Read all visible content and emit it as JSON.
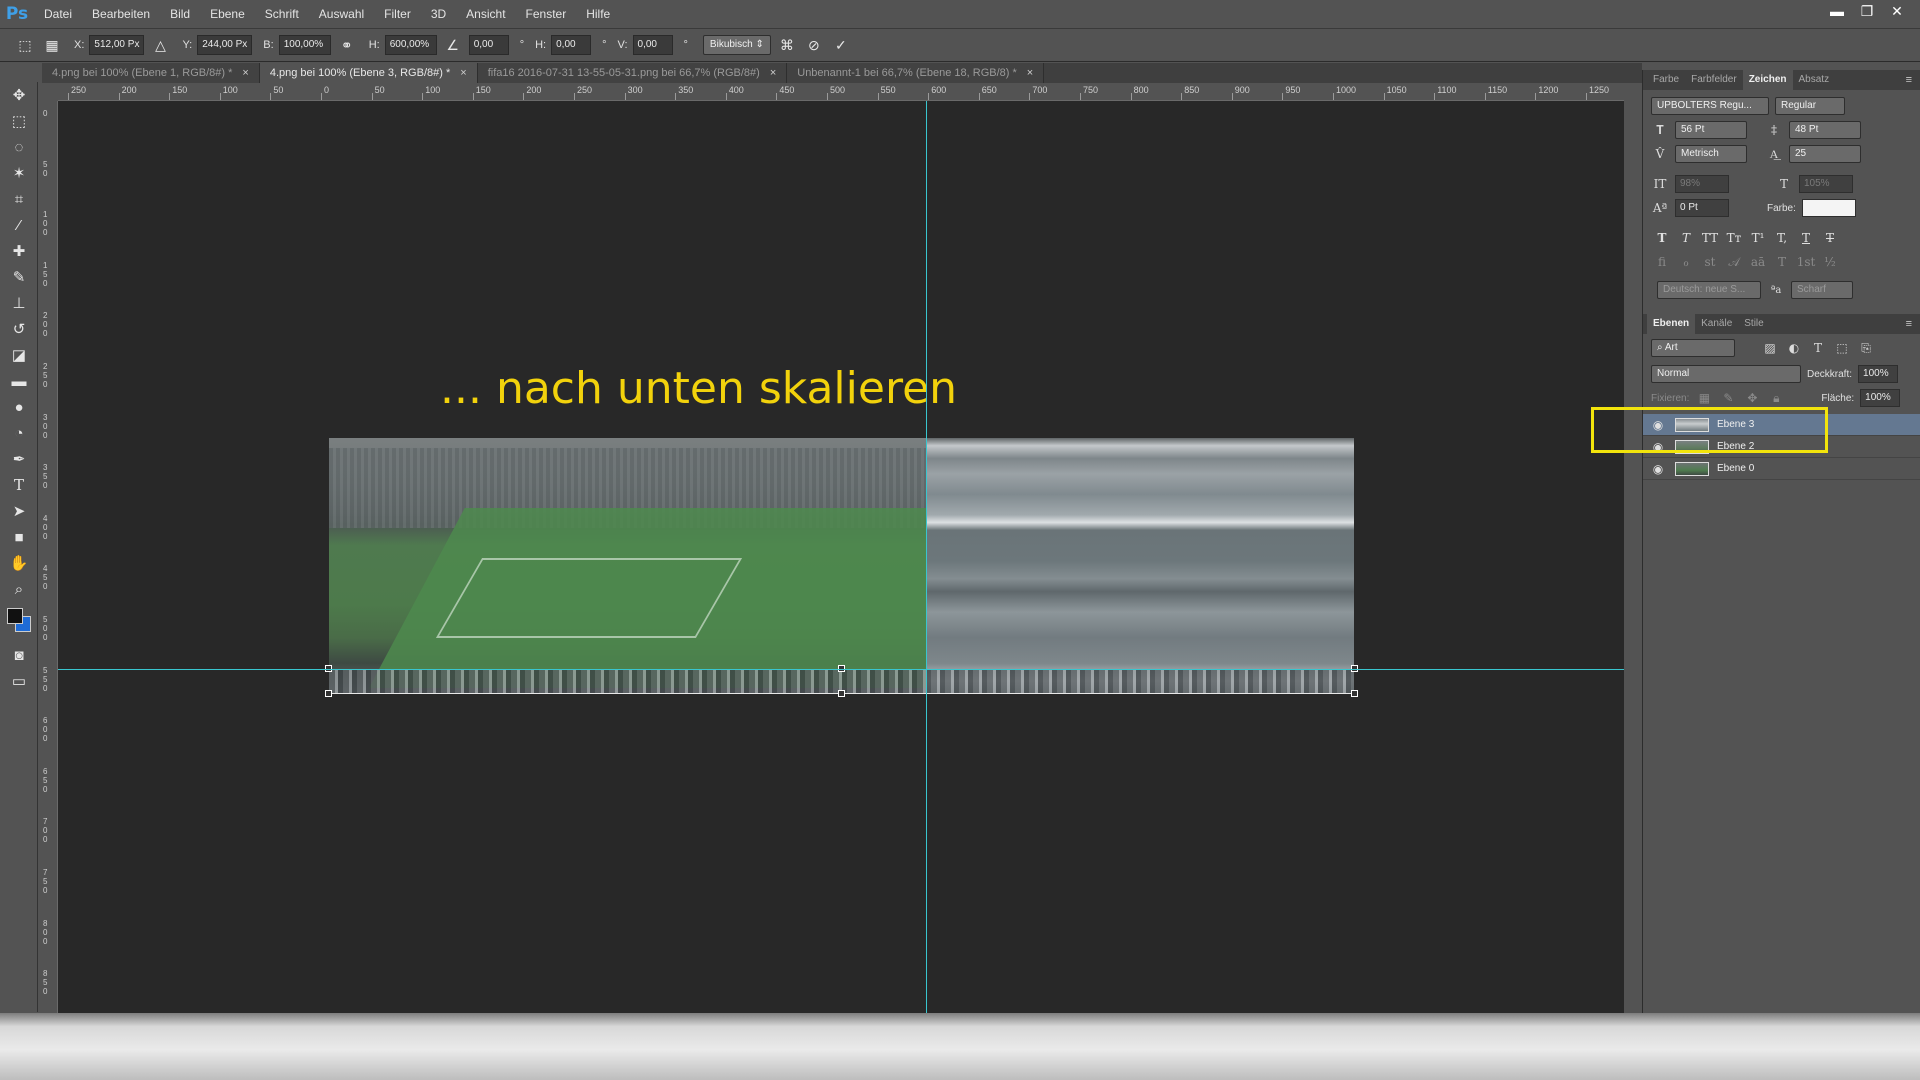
{
  "app": {
    "logo": "Ps"
  },
  "menu": [
    "Datei",
    "Bearbeiten",
    "Bild",
    "Ebene",
    "Schrift",
    "Auswahl",
    "Filter",
    "3D",
    "Ansicht",
    "Fenster",
    "Hilfe"
  ],
  "window_controls": {
    "minimize": "▬",
    "restore": "❐",
    "close": "✕"
  },
  "options": {
    "x_label": "X:",
    "x_value": "512,00 Px",
    "y_label": "Y:",
    "y_value": "244,00 Px",
    "w_label": "B:",
    "w_value": "100,00%",
    "h_label": "H:",
    "h_value": "600,00%",
    "angle_value": "0,00",
    "hskew_label": "H:",
    "hskew_value": "0,00",
    "vskew_label": "V:",
    "vskew_value": "0,00",
    "interpolation": "Bikubisch",
    "degree": "°"
  },
  "tabs": [
    {
      "label": "4.png bei 100% (Ebene 1, RGB/8#) *",
      "close": "×"
    },
    {
      "label": "4.png bei 100% (Ebene 3, RGB/8#) *",
      "close": "×"
    },
    {
      "label": "fifa16 2016-07-31 13-55-05-31.png bei 66,7% (RGB/8#)",
      "close": "×"
    },
    {
      "label": "Unbenannt-1 bei 66,7% (Ebene 18, RGB/8) *",
      "close": "×"
    }
  ],
  "ruler_top": [
    "250",
    "200",
    "150",
    "100",
    "50",
    "0",
    "50",
    "100",
    "150",
    "200",
    "250",
    "300",
    "350",
    "400",
    "450",
    "500",
    "550",
    "600",
    "650",
    "700",
    "750",
    "800",
    "850",
    "900",
    "950",
    "1000",
    "1050",
    "1100",
    "1150",
    "1200",
    "1250"
  ],
  "ruler_left": [
    "0",
    "5 0",
    "1 0 0",
    "1 5 0",
    "2 0 0",
    "2 5 0",
    "3 0 0",
    "3 5 0",
    "4 0 0",
    "4 5 0",
    "5 0 0",
    "5 5 0",
    "6 0 0",
    "6 5 0",
    "7 0 0",
    "7 5 0",
    "8 0 0",
    "8 5 0"
  ],
  "canvas": {
    "caption": "... nach unten skalieren"
  },
  "colors": {
    "caption": "#f2d20c",
    "guide": "#39c6cf",
    "highlight": "#f2e40c",
    "foreground": "#111111",
    "background": "#1e6bd6"
  },
  "char_panel": {
    "tabs": [
      "Farbe",
      "Farbfelder",
      "Zeichen",
      "Absatz"
    ],
    "font_family": "UPBOLTERS Regu...",
    "font_style": "Regular",
    "size": "56 Pt",
    "leading": "48 Pt",
    "kerning": "Metrisch",
    "tracking": "25",
    "vscale": "98%",
    "hscale": "105%",
    "baseline": "0 Pt",
    "color_label": "Farbe:",
    "style_buttons": [
      "T",
      "T",
      "TT",
      "Tт",
      "T¹",
      "T,",
      "T",
      "T"
    ],
    "opentype_buttons": [
      "ﬁ",
      "ℴ",
      "st",
      "𝒜",
      "aā",
      "T",
      "1st",
      "½"
    ],
    "language": "Deutsch: neue S...",
    "aa_icon": "ªa",
    "antialias": "Scharf"
  },
  "layers_panel": {
    "tabs": [
      "Ebenen",
      "Kanäle",
      "Stile"
    ],
    "filter": "Art",
    "blend_mode": "Normal",
    "opacity_label": "Deckkraft:",
    "opacity": "100%",
    "lock_label": "Fixieren:",
    "fill_label": "Fläche:",
    "fill": "100%",
    "layers": [
      {
        "name": "Ebene 3",
        "active": true
      },
      {
        "name": "Ebene 2",
        "active": false
      },
      {
        "name": "Ebene 0",
        "active": false
      }
    ]
  },
  "tools": [
    "move-icon",
    "marquee-icon",
    "lasso-icon",
    "magic-wand-icon",
    "crop-icon",
    "eyedropper-icon",
    "healing-brush-icon",
    "brush-icon",
    "stamp-icon",
    "history-brush-icon",
    "eraser-icon",
    "gradient-icon",
    "blur-icon",
    "dodge-icon",
    "pen-icon",
    "type-icon",
    "path-select-icon",
    "shape-icon",
    "hand-icon",
    "zoom-icon"
  ]
}
